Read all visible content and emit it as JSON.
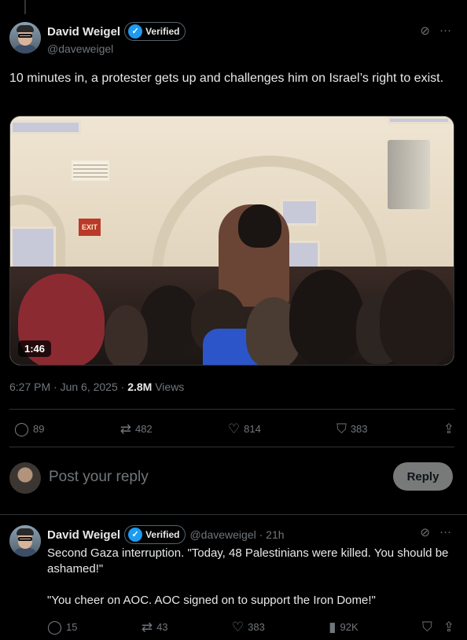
{
  "main_tweet": {
    "author": {
      "name": "David Weigel",
      "verified_label": "Verified",
      "handle": "@daveweigel"
    },
    "text": "10 minutes in, a protester gets up and challenges him on Israel’s right to exist.",
    "media": {
      "duration": "1:46",
      "sign": "EXIT"
    },
    "timestamp": "6:27 PM · Jun 6, 2025 · ",
    "views_count": "2.8M",
    "views_label": " Views",
    "stats": {
      "replies": "89",
      "reposts": "482",
      "likes": "814",
      "bookmarks": "383"
    }
  },
  "reply_composer": {
    "placeholder": "Post your reply",
    "button_label": "Reply"
  },
  "reply_tweet": {
    "author": {
      "name": "David Weigel",
      "verified_label": "Verified",
      "handle": "@daveweigel · 21h"
    },
    "paragraphs": [
      "Second Gaza interruption. \"Today, 48 Palestinians were killed. You should be ashamed!\"",
      "\"You cheer on AOC. AOC signed on to support the Iron Dome!\""
    ],
    "stats": {
      "replies": "15",
      "reposts": "43",
      "likes": "383",
      "views": "92K"
    }
  },
  "icons": {
    "reply": "speech-bubble-icon",
    "repost": "repost-arrows-icon",
    "like": "heart-icon",
    "bookmark": "bookmark-icon",
    "share": "share-icon",
    "views": "bar-chart-icon",
    "more": "more-dots-icon",
    "grok": "grok-icon",
    "verified": "verified-badge-icon"
  },
  "colors": {
    "background": "#000000",
    "text": "#e7e9ea",
    "muted": "#71767b",
    "accent": "#1d9bf0",
    "divider": "#2f3336"
  }
}
